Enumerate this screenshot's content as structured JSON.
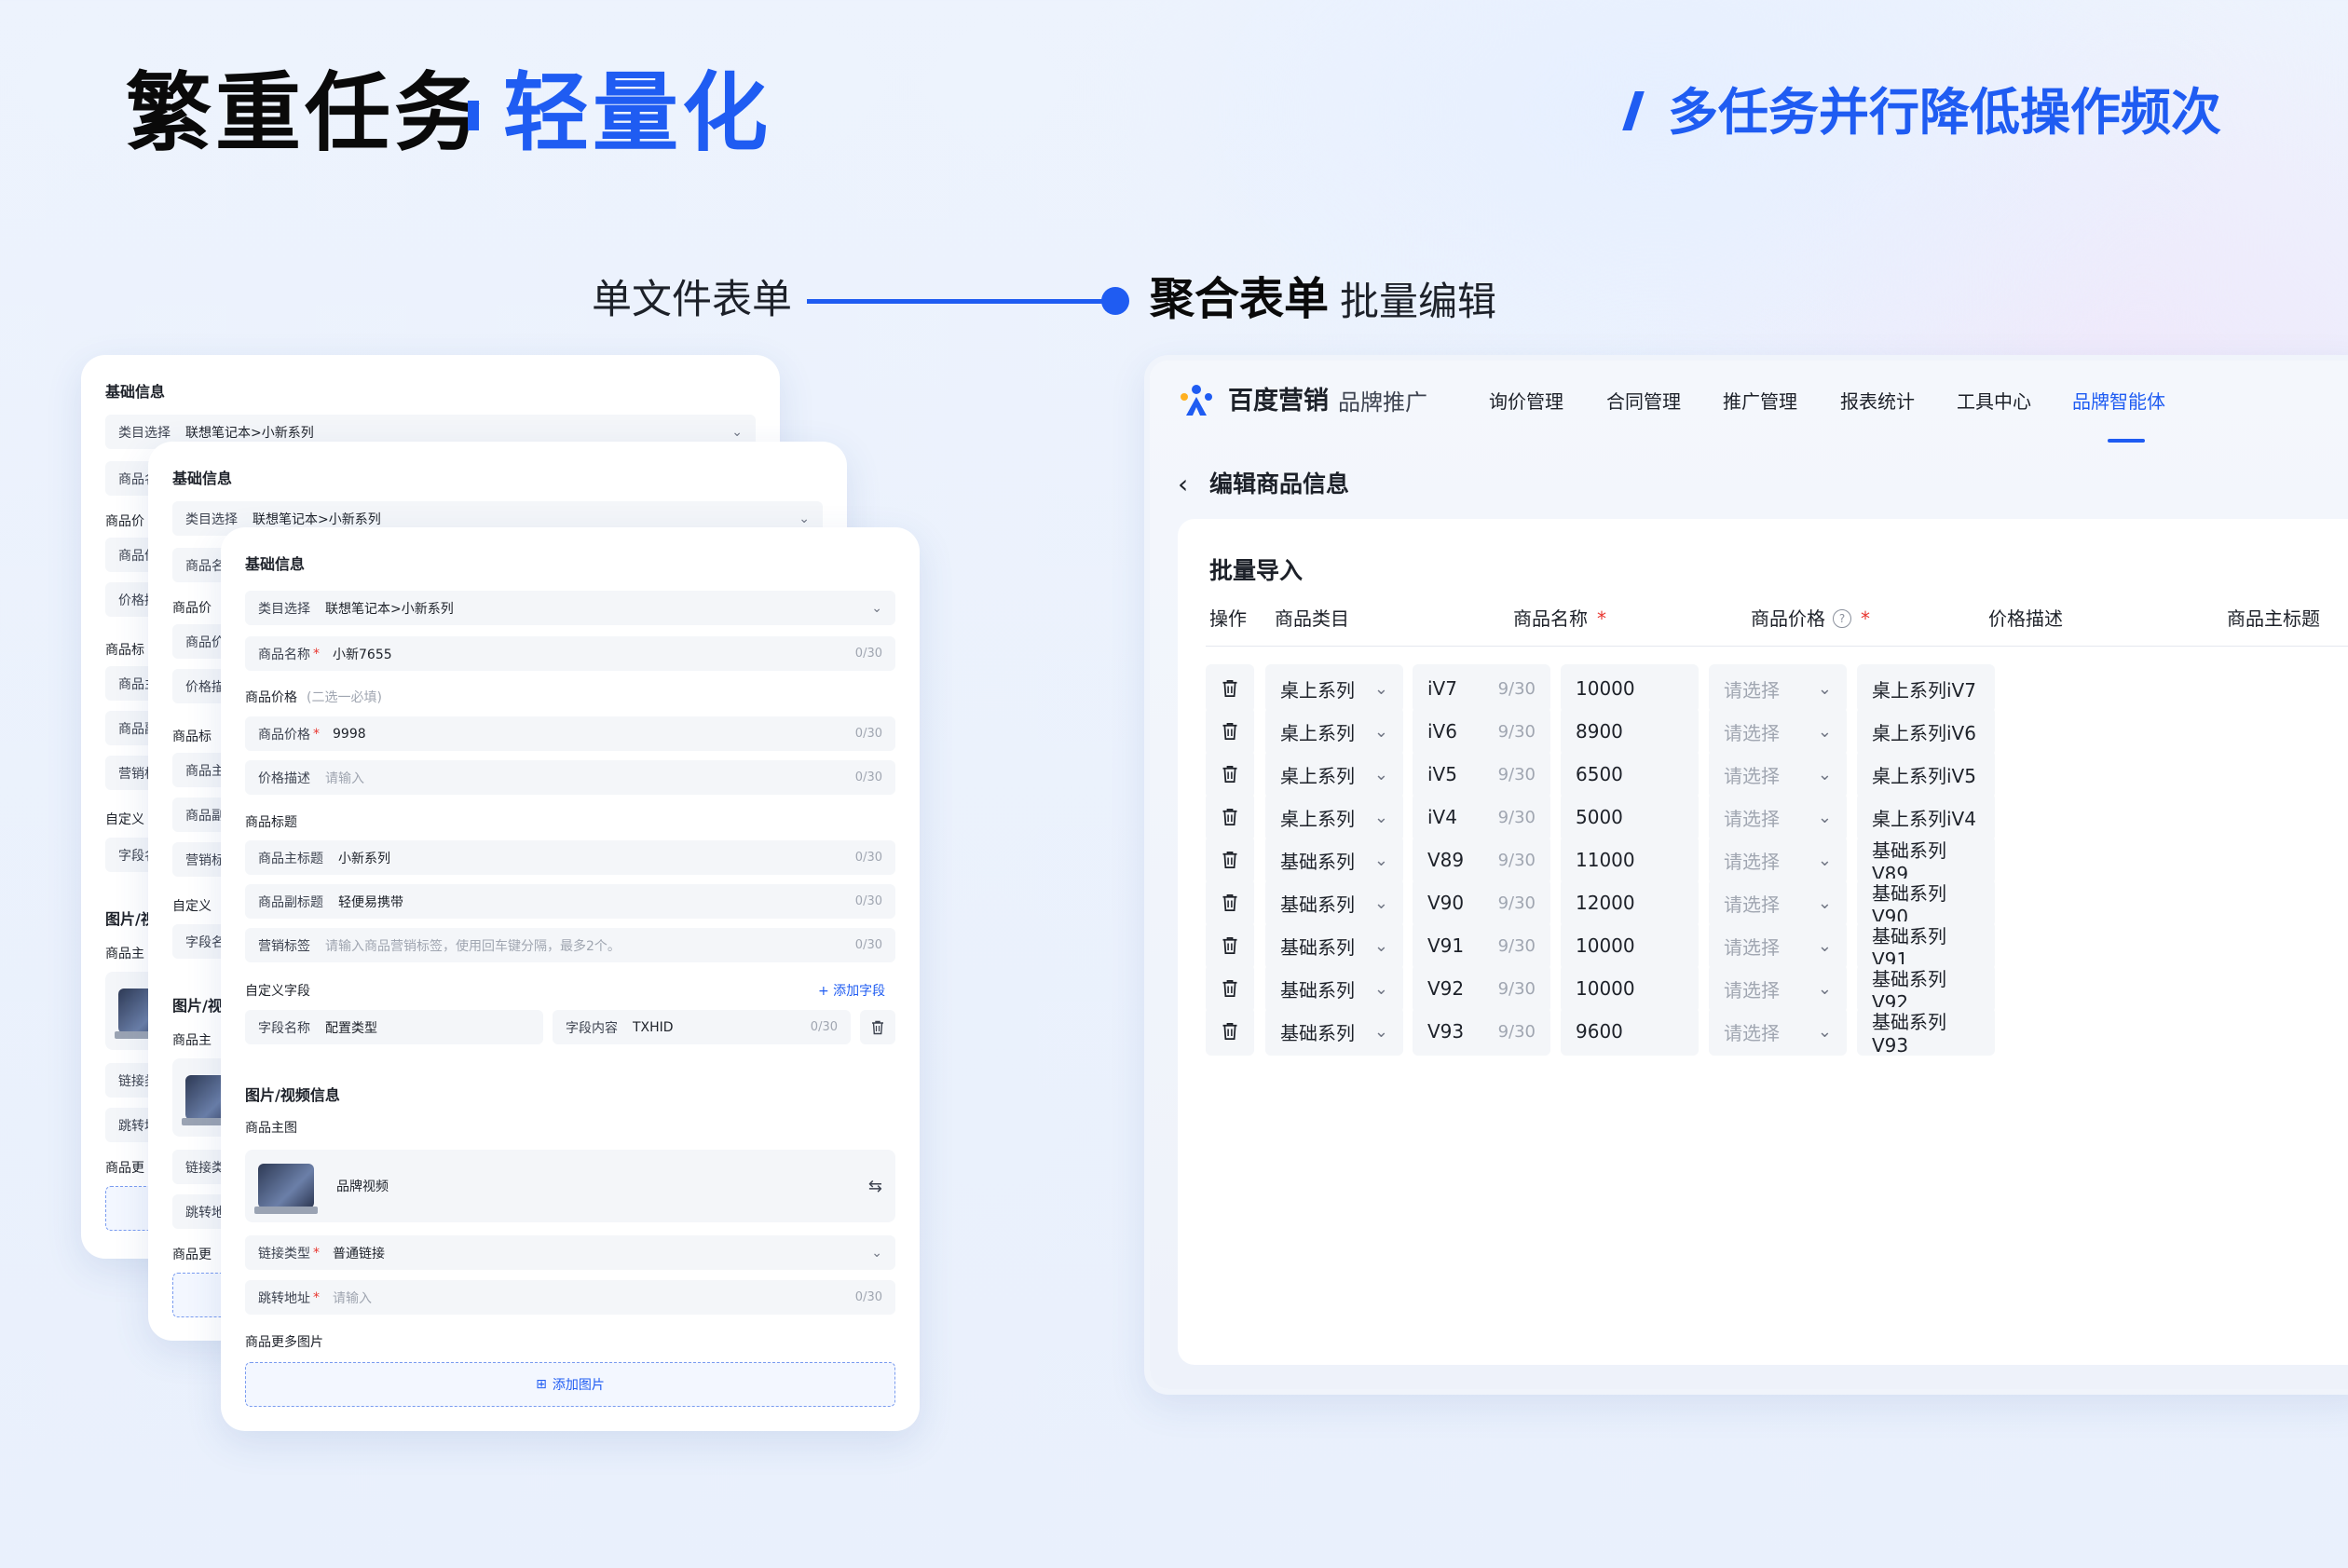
{
  "headline": {
    "main": "繁重任务",
    "highlight": "轻量化",
    "subtitle": "多任务并行降低操作频次"
  },
  "connector": {
    "left_label": "单文件表单",
    "right_bold": "聚合表单",
    "right_label": "批量编辑"
  },
  "form": {
    "sec_basic": "基础信息",
    "category_key": "类目选择",
    "category_value": "联想笔记本>小新系列",
    "name_key": "商品名称",
    "name_value": "小新7655",
    "count": "0/30",
    "price_sec": "商品价格",
    "price_hint": "(二选一必填)",
    "price_key": "商品价格",
    "price_value": "9998",
    "pdesc_key": "价格描述",
    "placeholder": "请输入",
    "title_sec": "商品标题",
    "main_title_key": "商品主标题",
    "main_title_value": "小新系列",
    "sub_title_key": "商品副标题",
    "sub_title_value": "轻便易携带",
    "tag_key": "营销标签",
    "tag_placeholder": "请输入商品营销标签，使用回车键分隔，最多2个。",
    "custom_sec": "自定义字段",
    "add_field": "+ 添加字段",
    "field_name_key": "字段名称",
    "field_name_value": "配置类型",
    "field_content_key": "字段内容",
    "field_content_value": "TXHID",
    "media_sec": "图片/视频信息",
    "main_img": "商品主图",
    "brand_video": "品牌视频",
    "link_type_key": "链接类型",
    "link_type_value": "普通链接",
    "jump_key": "跳转地址",
    "more_img": "商品更多图片",
    "add_img": "添加图片",
    "back_labels": {
      "category": "类目选择",
      "category_value": "联想笔记本>小新系列",
      "name": "商品名",
      "price_a": "商品价",
      "price_b": "商品价",
      "pdesc": "价格描",
      "title_a": "商品标",
      "title_b": "商品主",
      "title_c": "商品副",
      "tag": "营销标",
      "custom": "自定义",
      "field": "字段名",
      "media": "图片/视",
      "main_img": "商品主",
      "link": "链接类",
      "jump": "跳转地",
      "more": "商品更"
    }
  },
  "app": {
    "logo": "百度营销",
    "product": "品牌推广",
    "nav": [
      "询价管理",
      "合同管理",
      "推广管理",
      "报表统计",
      "工具中心",
      "品牌智能体"
    ],
    "back_title": "编辑商品信息",
    "panel_title": "批量导入",
    "columns": {
      "op": "操作",
      "cat": "商品类目",
      "name": "商品名称",
      "price": "商品价格",
      "pdesc": "价格描述",
      "mtitle": "商品主标题"
    },
    "select_placeholder": "请选择",
    "rows": [
      {
        "cat": "桌上系列",
        "name": "iV7",
        "count": "9/30",
        "price": "10000",
        "title": "桌上系列iV7"
      },
      {
        "cat": "桌上系列",
        "name": "iV6",
        "count": "9/30",
        "price": "8900",
        "title": "桌上系列iV6"
      },
      {
        "cat": "桌上系列",
        "name": "iV5",
        "count": "9/30",
        "price": "6500",
        "title": "桌上系列iV5"
      },
      {
        "cat": "桌上系列",
        "name": "iV4",
        "count": "9/30",
        "price": "5000",
        "title": "桌上系列iV4"
      },
      {
        "cat": "基础系列",
        "name": "V89",
        "count": "9/30",
        "price": "11000",
        "title": "基础系列V89"
      },
      {
        "cat": "基础系列",
        "name": "V90",
        "count": "9/30",
        "price": "12000",
        "title": "基础系列V90"
      },
      {
        "cat": "基础系列",
        "name": "V91",
        "count": "9/30",
        "price": "10000",
        "title": "基础系列V91"
      },
      {
        "cat": "基础系列",
        "name": "V92",
        "count": "9/30",
        "price": "10000",
        "title": "基础系列V92"
      },
      {
        "cat": "基础系列",
        "name": "V93",
        "count": "9/30",
        "price": "9600",
        "title": "基础系列V93"
      }
    ]
  },
  "colors": {
    "accent": "#1f5cf2",
    "required": "#e8362f"
  }
}
